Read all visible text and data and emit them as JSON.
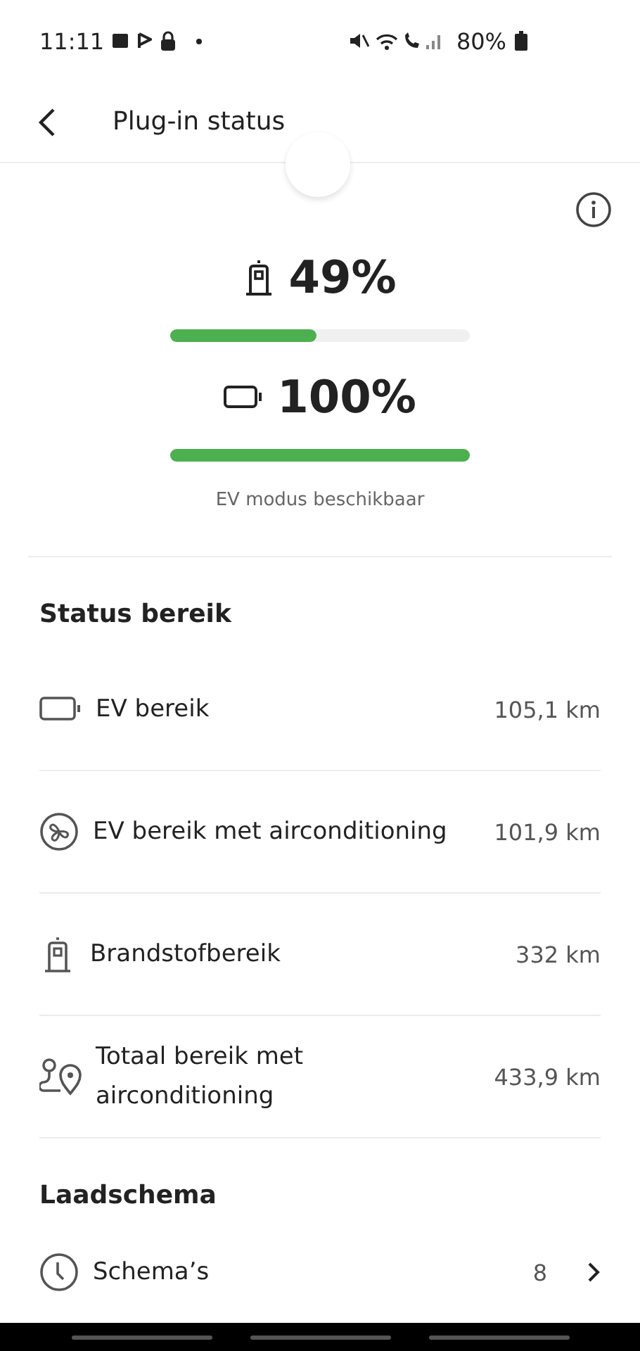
{
  "status_bar": {
    "time": "11:11",
    "battery": "80%"
  },
  "header": {
    "title": "Plug-in status"
  },
  "gauges": [
    {
      "kind": "fuel",
      "value": "49%",
      "level": 0.49
    },
    {
      "kind": "battery",
      "value": "100%",
      "level": 1.0
    }
  ],
  "gauge_caption": "EV modus beschikbaar",
  "range_section": {
    "title": "Status bereik",
    "rows": [
      {
        "kind": "battery",
        "label": "EV bereik",
        "value": "105,1 km"
      },
      {
        "kind": "fan",
        "label": "EV bereik met airconditioning",
        "value": "101,9 km"
      },
      {
        "kind": "fuel",
        "label": "Brandstofbereik",
        "value": "332 km"
      },
      {
        "kind": "route",
        "label": "Totaal bereik met airconditioning",
        "value": "433,9 km"
      }
    ]
  },
  "schedule_section": {
    "title": "Laadschema",
    "rows": [
      {
        "kind": "clock",
        "label": "Schema’s",
        "value": "8"
      }
    ]
  }
}
